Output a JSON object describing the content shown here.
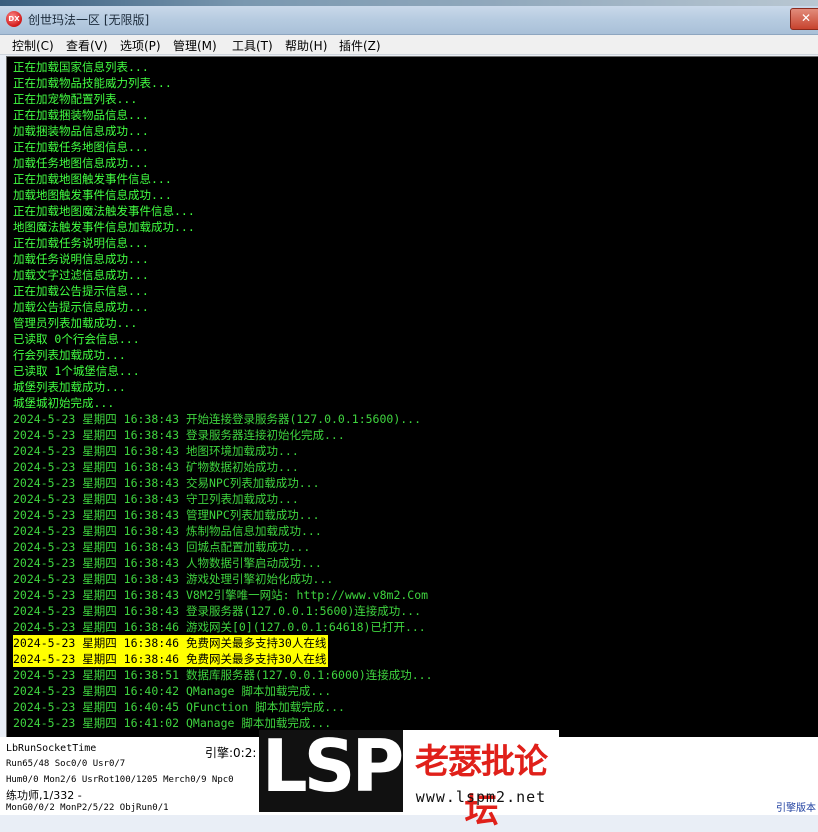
{
  "window": {
    "title": "创世玛法一区 [无限版]",
    "icon_label": "DX",
    "close_glyph": "✕"
  },
  "menu": [
    "控制(C)",
    "查看(V)",
    "选项(P)",
    "管理(M)",
    "工具(T)",
    "帮助(H)",
    "插件(Z)"
  ],
  "log": [
    {
      "text": "正在加载国家信息列表...",
      "style": "plain"
    },
    {
      "text": "正在加载物品技能威力列表...",
      "style": "plain"
    },
    {
      "text": "正在加宠物配置列表...",
      "style": "plain"
    },
    {
      "text": "正在加载捆装物品信息...",
      "style": "plain"
    },
    {
      "text": "加载捆装物品信息成功...",
      "style": "plain"
    },
    {
      "text": "正在加载任务地图信息...",
      "style": "plain"
    },
    {
      "text": "加载任务地图信息成功...",
      "style": "plain"
    },
    {
      "text": "正在加载地图触发事件信息...",
      "style": "plain"
    },
    {
      "text": "加载地图触发事件信息成功...",
      "style": "plain"
    },
    {
      "text": "正在加载地图魔法触发事件信息...",
      "style": "plain"
    },
    {
      "text": "地图魔法触发事件信息加载成功...",
      "style": "plain"
    },
    {
      "text": "正在加载任务说明信息...",
      "style": "plain"
    },
    {
      "text": "加载任务说明信息成功...",
      "style": "plain"
    },
    {
      "text": "加载文字过滤信息成功...",
      "style": "plain"
    },
    {
      "text": "正在加载公告提示信息...",
      "style": "plain"
    },
    {
      "text": "加载公告提示信息成功...",
      "style": "plain"
    },
    {
      "text": "管理员列表加载成功...",
      "style": "plain"
    },
    {
      "text": "已读取 0个行会信息...",
      "style": "plain"
    },
    {
      "text": "行会列表加载成功...",
      "style": "plain"
    },
    {
      "text": "已读取 1个城堡信息...",
      "style": "plain"
    },
    {
      "text": "城堡列表加载成功...",
      "style": "plain"
    },
    {
      "text": "城堡城初始完成...",
      "style": "plain"
    },
    {
      "text": "2024-5-23 星期四 16:38:43 开始连接登录服务器(127.0.0.1:5600)...",
      "style": "dated"
    },
    {
      "text": "2024-5-23 星期四 16:38:43 登录服务器连接初始化完成...",
      "style": "dated"
    },
    {
      "text": "2024-5-23 星期四 16:38:43 地图环境加载成功...",
      "style": "dated"
    },
    {
      "text": "2024-5-23 星期四 16:38:43 矿物数据初始成功...",
      "style": "dated"
    },
    {
      "text": "2024-5-23 星期四 16:38:43 交易NPC列表加载成功...",
      "style": "dated"
    },
    {
      "text": "2024-5-23 星期四 16:38:43 守卫列表加载成功...",
      "style": "dated"
    },
    {
      "text": "2024-5-23 星期四 16:38:43 管理NPC列表加载成功...",
      "style": "dated"
    },
    {
      "text": "2024-5-23 星期四 16:38:43 炼制物品信息加载成功...",
      "style": "dated"
    },
    {
      "text": "2024-5-23 星期四 16:38:43 回城点配置加载成功...",
      "style": "dated"
    },
    {
      "text": "2024-5-23 星期四 16:38:43 人物数据引擎启动成功...",
      "style": "dated"
    },
    {
      "text": "2024-5-23 星期四 16:38:43 游戏处理引擎初始化成功...",
      "style": "dated"
    },
    {
      "text": "2024-5-23 星期四 16:38:43 V8M2引擎唯一网站: http://www.v8m2.Com",
      "style": "dated"
    },
    {
      "text": "2024-5-23 星期四 16:38:43 登录服务器(127.0.0.1:5600)连接成功...",
      "style": "dated"
    },
    {
      "text": "2024-5-23 星期四 16:38:46 游戏网关[0](127.0.0.1:64618)已打开...",
      "style": "dated"
    },
    {
      "text": "2024-5-23 星期四 16:38:46 免费网关最多支持30人在线",
      "style": "hl"
    },
    {
      "text": "2024-5-23 星期四 16:38:46 免费网关最多支持30人在线",
      "style": "hl"
    },
    {
      "text": "2024-5-23 星期四 16:38:51 数据库服务器(127.0.0.1:6000)连接成功...",
      "style": "dated"
    },
    {
      "text": "2024-5-23 星期四 16:40:42 QManage 脚本加载完成...",
      "style": "dated"
    },
    {
      "text": "2024-5-23 星期四 16:40:45 QFunction 脚本加载完成...",
      "style": "dated"
    },
    {
      "text": "2024-5-23 星期四 16:41:02 QManage 脚本加载完成...",
      "style": "dated"
    }
  ],
  "status": {
    "line1": "LbRunSocketTime",
    "engine_label": "引擎:0:2:",
    "line2": "Run65/48 Soc0/0 Usr0/7",
    "line3": "Hum0/0 Mon2/6 UsrRot100/1205 Merch0/9 Npc0",
    "line4": "练功师,1/332 -",
    "line5": "MonG0/0/2 MonP2/5/22 ObjRun0/1",
    "engine_version": "引擎版本"
  },
  "watermark": {
    "brand": "LSP",
    "cn": "老瑟批论坛",
    "url": "www.lspm2.net"
  }
}
